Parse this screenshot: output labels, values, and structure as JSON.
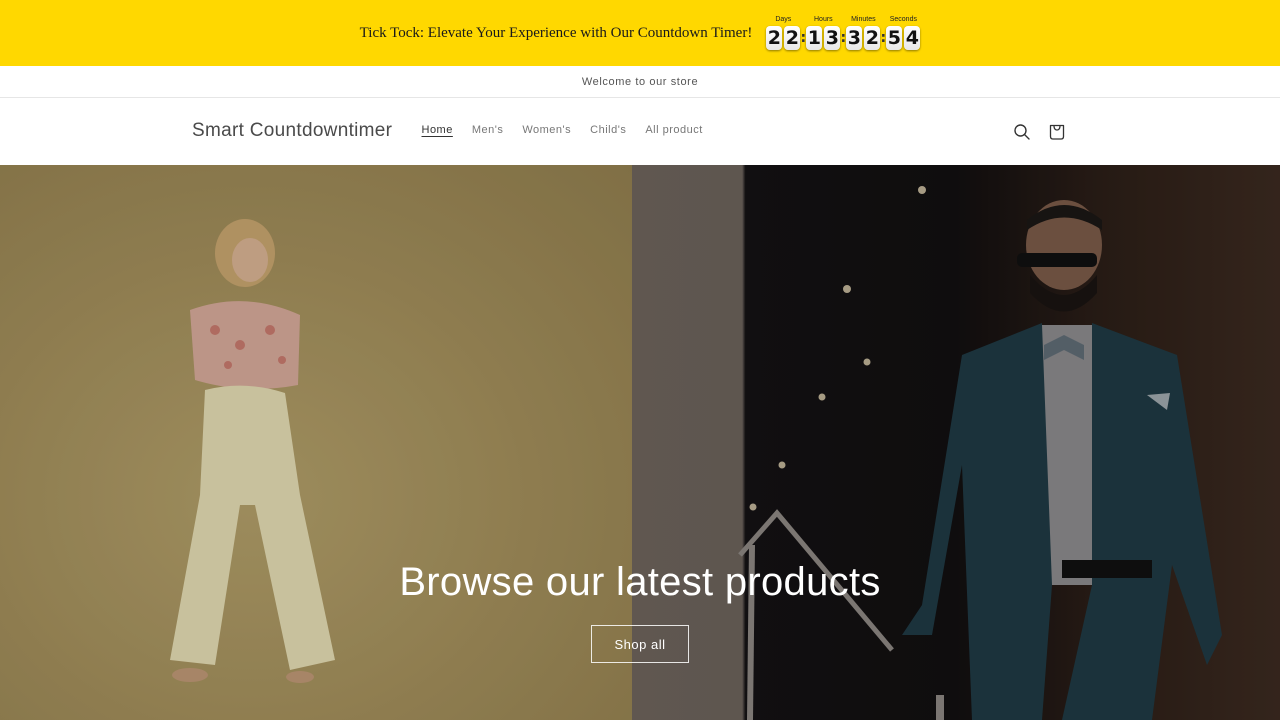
{
  "timer_bar": {
    "message": "Tick Tock: Elevate Your Experience with Our Countdown Timer!",
    "background_color": "#ffd800",
    "units": [
      {
        "label": "Days",
        "digits": [
          "2",
          "2"
        ]
      },
      {
        "label": "Hours",
        "digits": [
          "1",
          "3"
        ]
      },
      {
        "label": "Minutes",
        "digits": [
          "3",
          "2"
        ]
      },
      {
        "label": "Seconds",
        "digits": [
          "5",
          "4"
        ]
      }
    ]
  },
  "announcement": {
    "text": "Welcome to our store"
  },
  "header": {
    "logo": "Smart Countdowntimer",
    "nav": [
      {
        "label": "Home",
        "active": true
      },
      {
        "label": "Men's",
        "active": false
      },
      {
        "label": "Women's",
        "active": false
      },
      {
        "label": "Child's",
        "active": false
      },
      {
        "label": "All product",
        "active": false
      }
    ],
    "icons": [
      "search-icon",
      "cart-icon"
    ]
  },
  "hero": {
    "title": "Browse our latest products",
    "button_label": "Shop all",
    "left_image": "woman-in-floral-top-and-cream-trousers",
    "right_image": "man-in-teal-suit-with-bow-tie"
  }
}
